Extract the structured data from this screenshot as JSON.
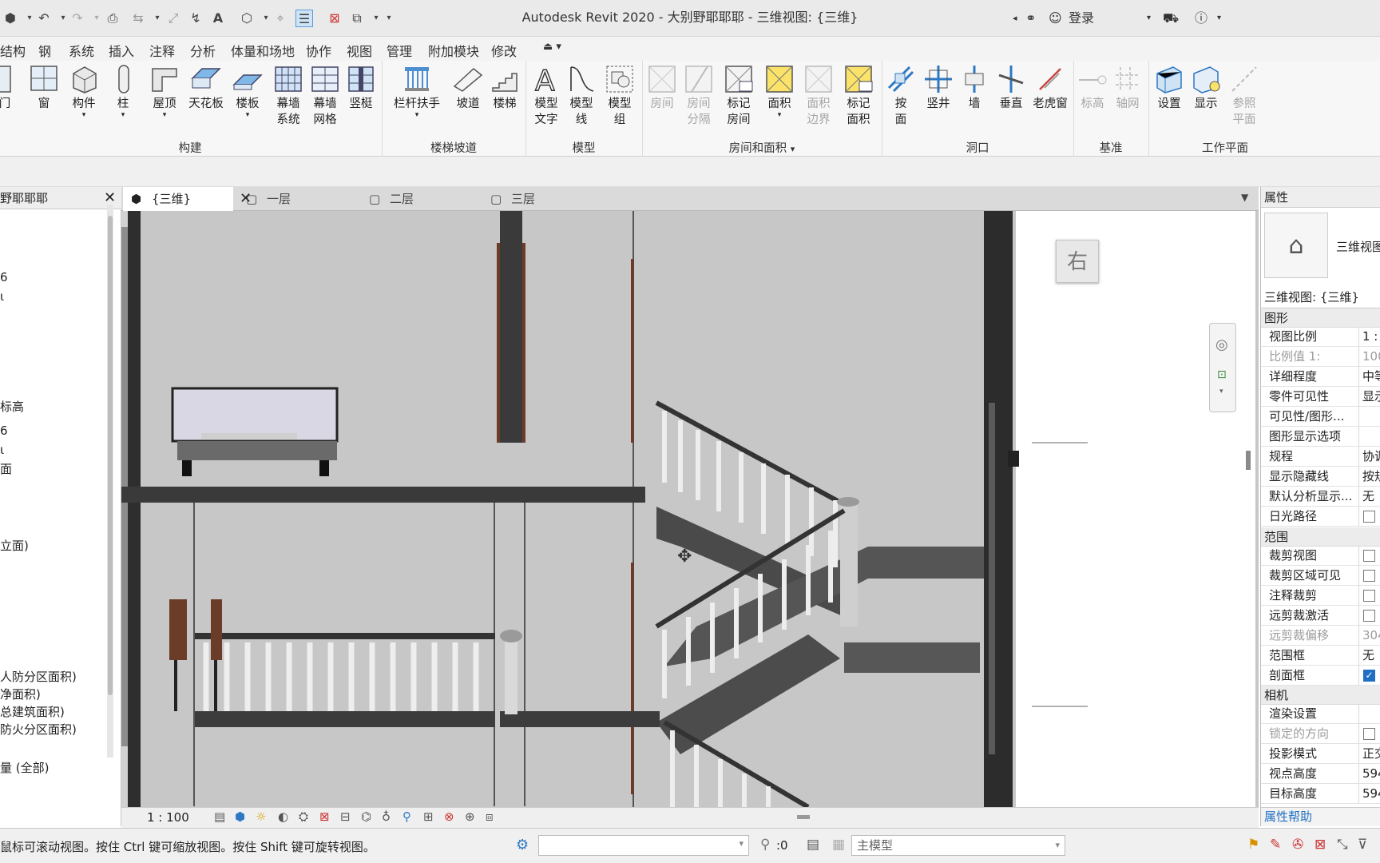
{
  "window": {
    "title": "Autodesk Revit 2020 - 大别野耶耶耶 - 三维视图: {三维}",
    "login": "登录"
  },
  "menu": [
    "结构",
    "钢",
    "系统",
    "插入",
    "注释",
    "分析",
    "体量和场地",
    "协作",
    "视图",
    "管理",
    "附加模块",
    "修改"
  ],
  "ribbon": {
    "build": [
      {
        "label": "门"
      },
      {
        "label": "窗"
      },
      {
        "label": "构件"
      },
      {
        "label": "柱"
      },
      {
        "label": "屋顶"
      },
      {
        "label": "天花板"
      },
      {
        "label": "楼板"
      },
      {
        "label": "幕墙\n系统"
      },
      {
        "label": "幕墙\n网格"
      },
      {
        "label": "竖梃"
      }
    ],
    "stairs": [
      {
        "label": "栏杆扶手"
      },
      {
        "label": "坡道"
      },
      {
        "label": "楼梯"
      }
    ],
    "model": [
      {
        "label": "模型\n文字"
      },
      {
        "label": "模型\n线"
      },
      {
        "label": "模型\n组"
      }
    ],
    "rooms": [
      {
        "label": "房间"
      },
      {
        "label": "房间\n分隔"
      },
      {
        "label": "标记\n房间"
      },
      {
        "label": "面积"
      },
      {
        "label": "面积\n边界"
      },
      {
        "label": "标记\n面积"
      }
    ],
    "openings": [
      {
        "label": "按\n面"
      },
      {
        "label": "竖井"
      },
      {
        "label": "墙"
      },
      {
        "label": "垂直"
      },
      {
        "label": "老虎窗"
      }
    ],
    "datum": [
      {
        "label": "标高"
      },
      {
        "label": "轴网"
      }
    ],
    "workplane": [
      {
        "label": "设置"
      },
      {
        "label": "显示"
      },
      {
        "label": "参照\n平面"
      }
    ],
    "groups": {
      "build": "构建",
      "stairs": "楼梯坡道",
      "model": "模型",
      "rooms": "房间和面积",
      "openings": "洞口",
      "datum": "基准",
      "workplane": "工作平面"
    }
  },
  "browser": {
    "title": "野耶耶耶",
    "items": [
      "6",
      "ι",
      "标高",
      "6",
      "ι",
      "面",
      "立面)",
      "人防分区面积)",
      "净面积)",
      "总建筑面积)",
      "防火分区面积)",
      "量 (全部)"
    ]
  },
  "tabs": [
    {
      "label": "{三维}"
    },
    {
      "label": "一层"
    },
    {
      "label": "二层"
    },
    {
      "label": "三层"
    }
  ],
  "viewcube": {
    "face": "右"
  },
  "viewbar": {
    "scale": "1 : 100"
  },
  "properties": {
    "title": "属性",
    "type_name": "三维视图",
    "instance": "三维视图: {三维}",
    "help": "属性帮助",
    "categories": {
      "graphics": "图形",
      "extents": "范围",
      "camera": "相机"
    },
    "graphics": [
      {
        "k": "视图比例",
        "v": "1 :"
      },
      {
        "k": "比例值 1:",
        "v": "100",
        "dim": true
      },
      {
        "k": "详细程度",
        "v": "中等"
      },
      {
        "k": "零件可见性",
        "v": "显示"
      },
      {
        "k": "可见性/图形...",
        "v": ""
      },
      {
        "k": "图形显示选项",
        "v": ""
      },
      {
        "k": "规程",
        "v": "协调"
      },
      {
        "k": "显示隐藏线",
        "v": "按规"
      },
      {
        "k": "默认分析显示...",
        "v": "无"
      },
      {
        "k": "日光路径",
        "v": "",
        "cb": "off"
      }
    ],
    "extents": [
      {
        "k": "裁剪视图",
        "v": "",
        "cb": "off"
      },
      {
        "k": "裁剪区域可见",
        "v": "",
        "cb": "off"
      },
      {
        "k": "注释裁剪",
        "v": "",
        "cb": "off"
      },
      {
        "k": "远剪裁激活",
        "v": "",
        "cb": "off"
      },
      {
        "k": "远剪裁偏移",
        "v": "304",
        "dim": true
      },
      {
        "k": "范围框",
        "v": "无"
      },
      {
        "k": "剖面框",
        "v": "",
        "cb": "on"
      }
    ],
    "camera": [
      {
        "k": "渲染设置",
        "v": ""
      },
      {
        "k": "锁定的方向",
        "v": "",
        "dim": true,
        "cb": "off"
      },
      {
        "k": "投影模式",
        "v": "正交"
      },
      {
        "k": "视点高度",
        "v": "594"
      },
      {
        "k": "目标高度",
        "v": "594"
      }
    ]
  },
  "status": {
    "hint": "鼠标可滚动视图。按住 Ctrl 键可缩放视图。按住 Shift 键可旋转视图。",
    "selected_count": ":0",
    "model": "主模型"
  }
}
